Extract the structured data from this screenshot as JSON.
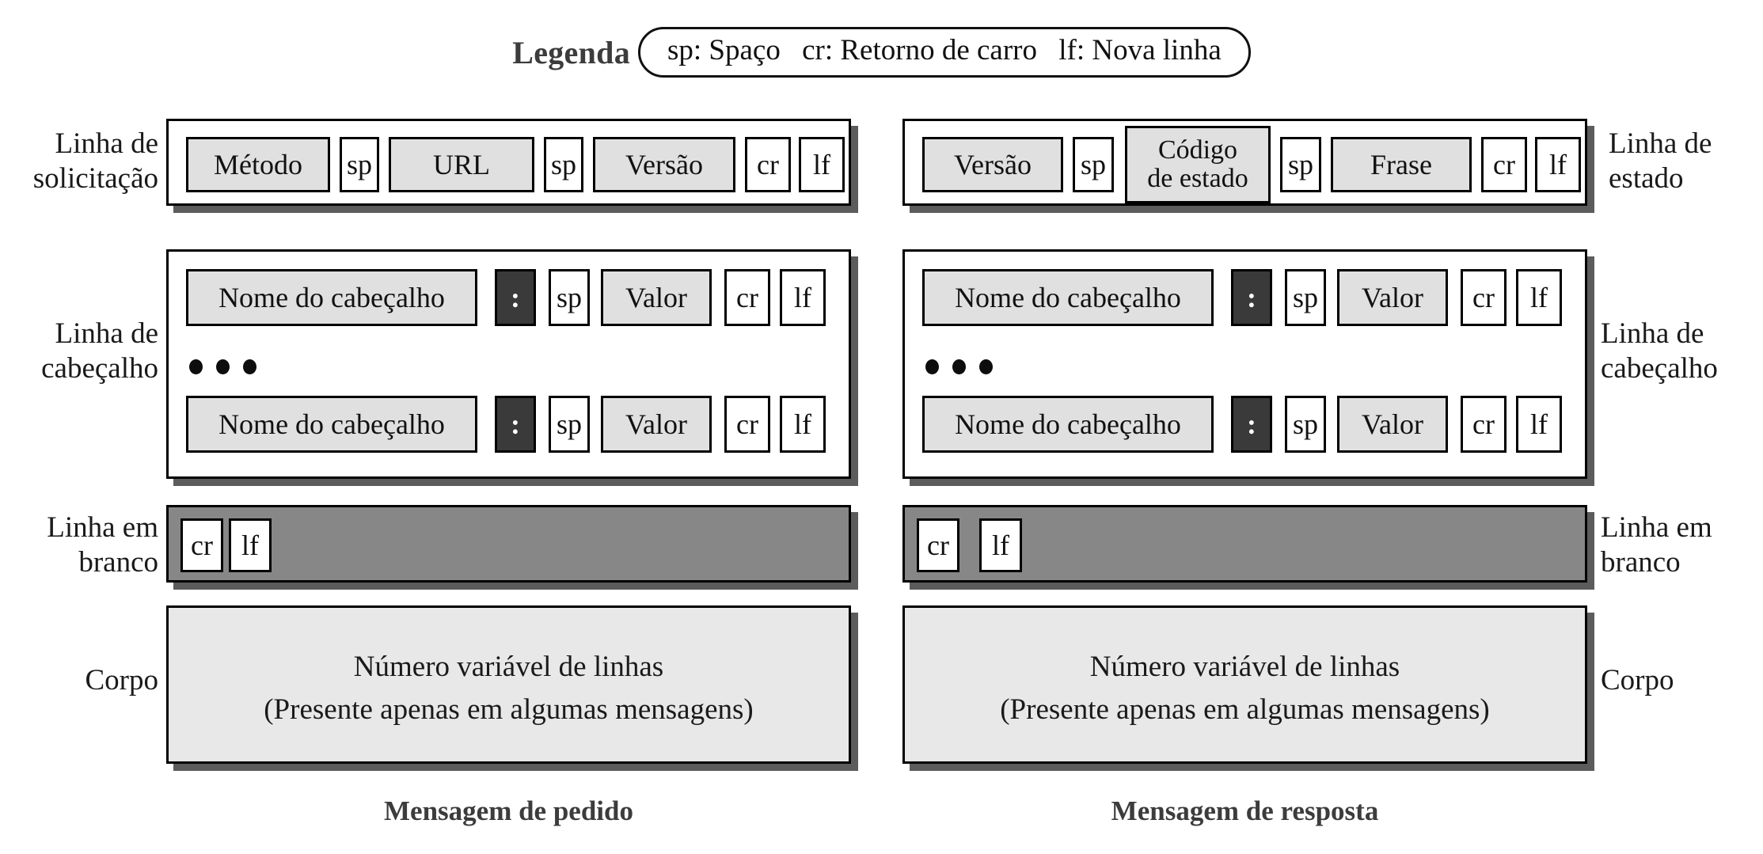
{
  "legend": {
    "label": "Legenda",
    "entries": [
      "sp: Spaço",
      "cr: Retorno de carro",
      "lf: Nova linha"
    ]
  },
  "request": {
    "caption": "Mensagem de pedido",
    "rows": {
      "start_line": {
        "label": "Linha de solicitação",
        "label_lines": [
          "Linha de",
          "solicitação"
        ],
        "tokens": [
          "Método",
          "sp",
          "URL",
          "sp",
          "Versão",
          "cr",
          "lf"
        ]
      },
      "header_lines": {
        "label": "Linha de cabeçalho",
        "label_lines": [
          "Linha de",
          "cabeçalho"
        ],
        "first": [
          "Nome do cabeçalho",
          ":",
          "sp",
          "Valor",
          "cr",
          "lf"
        ],
        "last": [
          "Nome do cabeçalho",
          ":",
          "sp",
          "Valor",
          "cr",
          "lf"
        ],
        "ellipsis": "•••"
      },
      "blank_line": {
        "label": "Linha em branco",
        "label_lines": [
          "Linha em",
          "branco"
        ],
        "tokens": [
          "cr",
          "lf"
        ]
      },
      "body": {
        "label": "Corpo",
        "label_lines": [
          "Corpo"
        ],
        "text_lines": [
          "Número variável de linhas",
          "(Presente apenas em algumas mensagens)"
        ]
      }
    }
  },
  "response": {
    "caption": "Mensagem de resposta",
    "rows": {
      "start_line": {
        "label": "Linha de estado",
        "label_lines": [
          "Linha de",
          "estado"
        ],
        "tokens": [
          "Versão",
          "sp",
          "Código de estado",
          "sp",
          "Frase",
          "cr",
          "lf"
        ],
        "status_code_lines": [
          "Código",
          "de estado"
        ]
      },
      "header_lines": {
        "label": "Linha de cabeçalho",
        "label_lines": [
          "Linha de",
          "cabeçalho"
        ],
        "first": [
          "Nome do cabeçalho",
          ":",
          "sp",
          "Valor",
          "cr",
          "lf"
        ],
        "last": [
          "Nome do cabeçalho",
          ":",
          "sp",
          "Valor",
          "cr",
          "lf"
        ],
        "ellipsis": "•••"
      },
      "blank_line": {
        "label": "Linha em branco",
        "label_lines": [
          "Linha em",
          "branco"
        ],
        "tokens": [
          "cr",
          "lf"
        ]
      },
      "body": {
        "label": "Corpo",
        "label_lines": [
          "Corpo"
        ],
        "text_lines": [
          "Número variável de linhas",
          "(Presente apenas em algumas mensagens)"
        ]
      }
    }
  },
  "colors": {
    "shaded_field": "#e0e0e0",
    "panel_body": "#e8e8e8",
    "blank_line_bar": "#878787",
    "colon_box": "#3a3a3a",
    "shadow": "#5c5c5c",
    "outline": "#000000"
  }
}
